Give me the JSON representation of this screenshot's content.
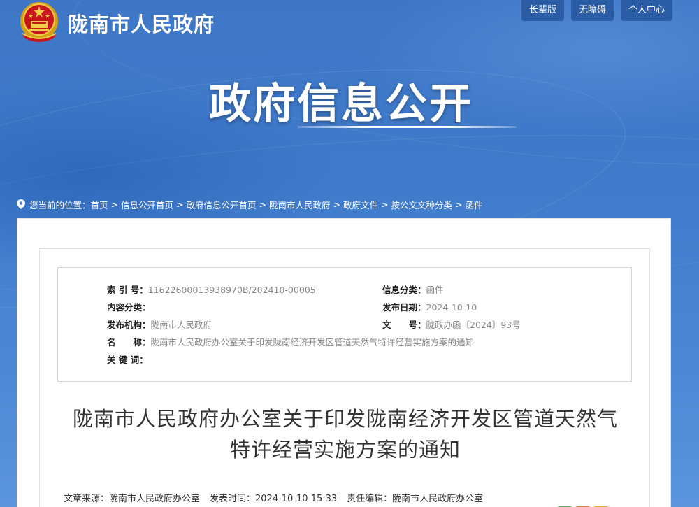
{
  "header": {
    "site_name": "陇南市人民政府",
    "buttons": [
      "长辈版",
      "无障碍",
      "个人中心"
    ],
    "hero_title": "政府信息公开"
  },
  "breadcrumb": {
    "prefix": "您当前的位置：",
    "items": [
      "首页",
      "信息公开首页",
      "政府信息公开首页",
      "陇南市人民政府",
      "政府文件",
      "按公文文种分类",
      "函件"
    ],
    "separator": ">"
  },
  "info": {
    "index_label": "索 引 号：",
    "index_value": "11622600013938970B/202410-00005",
    "category_label": "信息分类：",
    "category_value": "函件",
    "content_label": "内容分类：",
    "content_value": "",
    "date_label": "发布日期：",
    "date_value": "2024-10-10",
    "org_label": "发布机构：",
    "org_value": "陇南市人民政府",
    "docno_label": "文　　号：",
    "docno_value": "陇政办函〔2024〕93号",
    "name_label": "名　　称：",
    "name_value": "陇南市人民政府办公室关于印发陇南经济开发区管道天然气特许经营实施方案的通知",
    "keywords_label": "关 键 词：",
    "keywords_value": ""
  },
  "article": {
    "title_line1": "陇南市人民政府办公室关于印发陇南经济开发区管道天然气",
    "title_line2": "特许经营实施方案的通知",
    "source": "文章来源：陇南市人民政府办公室",
    "time": "发表时间：2024-10-10 15:33",
    "editor": "责任编辑：陇南市人民政府办公室"
  },
  "colors": {
    "banner": "#3f7bcb",
    "button_bg": "#2b5da6",
    "share_green": "#4caf50",
    "share_orange": "#e67e22",
    "share_yellow": "#f0a830"
  },
  "icons": [
    "national-emblem-icon",
    "location-pin-icon"
  ]
}
